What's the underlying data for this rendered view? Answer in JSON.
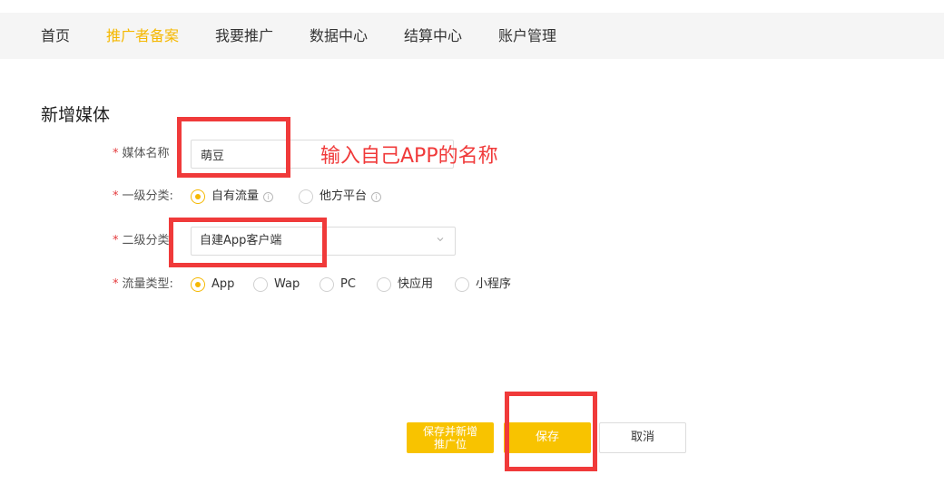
{
  "nav": {
    "items": [
      {
        "label": "首页",
        "active": false
      },
      {
        "label": "推广者备案",
        "active": true
      },
      {
        "label": "我要推广",
        "active": false
      },
      {
        "label": "数据中心",
        "active": false
      },
      {
        "label": "结算中心",
        "active": false
      },
      {
        "label": "账户管理",
        "active": false
      }
    ],
    "accent": "#f5b800"
  },
  "page_title": "新增媒体",
  "form": {
    "required_mark": "*",
    "media_name": {
      "label": "媒体名称",
      "value": "萌豆"
    },
    "level1": {
      "label": "一级分类:",
      "options": [
        {
          "label": "自有流量",
          "checked": true,
          "info_icon": "info-icon"
        },
        {
          "label": "他方平台",
          "checked": false,
          "info_icon": "info-icon"
        }
      ]
    },
    "level2": {
      "label": "二级分类",
      "value": "自建App客户端"
    },
    "traffic_type": {
      "label": "流量类型:",
      "options": [
        {
          "label": "App",
          "checked": true
        },
        {
          "label": "Wap",
          "checked": false
        },
        {
          "label": "PC",
          "checked": false
        },
        {
          "label": "快应用",
          "checked": false
        },
        {
          "label": "小程序",
          "checked": false
        }
      ]
    }
  },
  "annotation": {
    "text": "输入自己APP的名称",
    "color": "#f03a3a"
  },
  "buttons": {
    "save_and_new_line1": "保存并新增",
    "save_and_new_line2": "推广位",
    "save": "保存",
    "cancel": "取消"
  },
  "info_glyph": "i"
}
